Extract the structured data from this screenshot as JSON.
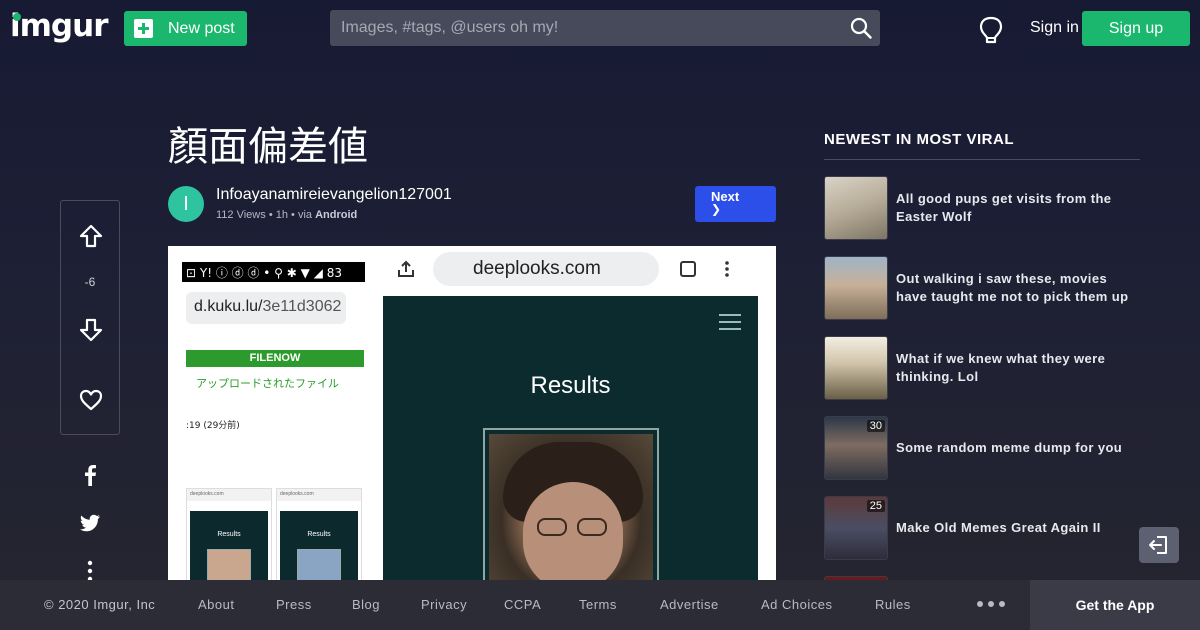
{
  "header": {
    "logo": "imgur",
    "new_post_label": "New post",
    "search_placeholder": "Images, #tags, @users oh my!",
    "sign_in_label": "Sign in",
    "sign_up_label": "Sign up"
  },
  "post": {
    "title": "顏面偏差値",
    "avatar_letter": "I",
    "author": "Infoayanamireievangelion127001",
    "views": "112 Views",
    "age": "1h",
    "via_prefix": "via",
    "via_platform": "Android",
    "next_label": "Next",
    "score": "-6"
  },
  "image_content": {
    "status_bar": "⊡ Y! ⓘ ⓓ ⓓ  • ⚲ ✱ ▼ ◢ 83",
    "left_url_host": "d.kuku.lu/",
    "left_url_path": "3e11d3062",
    "banner": "FILENOW",
    "upload_text": "アップロードされたファイル",
    "time_text": ":19 (29分前)",
    "right_url": "deeplooks.com",
    "results_title": "Results",
    "mini_url": "deeplooks.com",
    "mini_results": "Results"
  },
  "sidebar": {
    "heading": "NEWEST IN MOST VIRAL",
    "items": [
      {
        "title": "All good pups get visits from the Easter Wolf",
        "count": ""
      },
      {
        "title": "Out walking i saw these, movies have taught me not to pick them up",
        "count": ""
      },
      {
        "title": "What if we knew what they were thinking. Lol",
        "count": ""
      },
      {
        "title": "Some random meme dump for you",
        "count": "30"
      },
      {
        "title": "Make Old Memes Great Again II",
        "count": "25"
      }
    ]
  },
  "footer": {
    "copyright": "© 2020 Imgur, Inc",
    "links": [
      "About",
      "Press",
      "Blog",
      "Privacy",
      "CCPA",
      "Terms",
      "Advertise",
      "Ad Choices",
      "Rules"
    ],
    "get_app_label": "Get the App"
  },
  "colors": {
    "accent_green": "#1bb76e",
    "next_blue": "#2c4fea",
    "background": "#1d1f35",
    "footer_bg": "#2b2c35"
  }
}
